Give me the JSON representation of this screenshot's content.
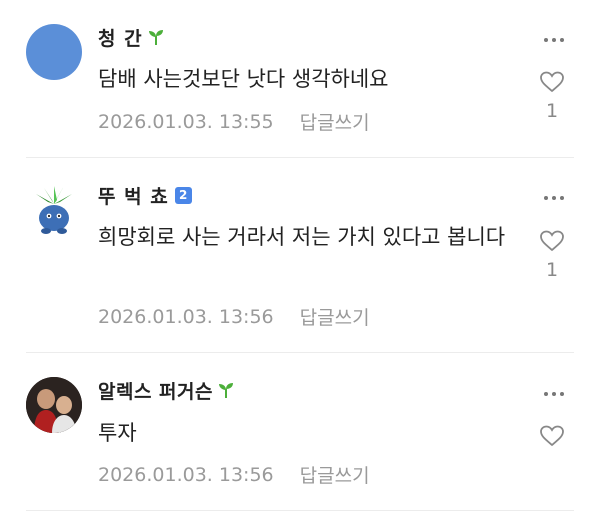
{
  "comments": [
    {
      "author": "청 간",
      "badge": "sprout",
      "text": "담배 사는것보단 낫다 생각하네요",
      "date": "2026.01.03. 13:55",
      "reply_label": "답글쓰기",
      "like_count": "1"
    },
    {
      "author": "뚜 벅 쵸",
      "badge": "level",
      "badge_text": "2",
      "text": "희망회로 사는 거라서 저는 가치 있다고 봅니다",
      "date": "2026.01.03. 13:56",
      "reply_label": "답글쓰기",
      "like_count": "1"
    },
    {
      "author": "알렉스 퍼거슨",
      "badge": "sprout",
      "text": "투자",
      "date": "2026.01.03. 13:56",
      "reply_label": "답글쓰기",
      "like_count": ""
    }
  ],
  "colors": {
    "avatar_blue": "#5b8fd8",
    "sprout_green": "#4caf3a",
    "level_badge": "#4a86e8",
    "meta_gray": "#9a9a9a"
  },
  "icons": [
    "more-icon",
    "heart-icon",
    "sprout-icon"
  ]
}
